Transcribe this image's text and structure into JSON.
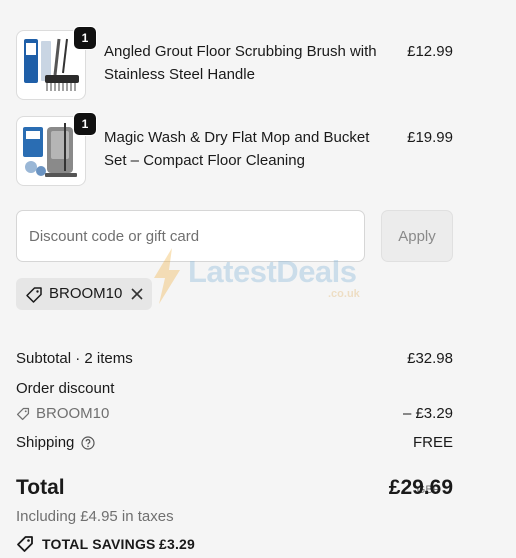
{
  "items": [
    {
      "name": "Angled Grout Floor Scrubbing Brush with Stainless Steel Handle",
      "price": "£12.99",
      "quantity": "1",
      "image_icon": "scrubbing-brush-icon"
    },
    {
      "name": "Magic Wash & Dry Flat Mop and Bucket Set – Compact Floor Cleaning",
      "price": "£19.99",
      "quantity": "1",
      "image_icon": "mop-bucket-icon"
    }
  ],
  "discount": {
    "placeholder": "Discount code or gift card",
    "apply_label": "Apply",
    "applied_code": "BROOM10"
  },
  "watermark": {
    "text": "LatestDeals",
    "sub": ".co.uk"
  },
  "summary": {
    "subtotal_label": "Subtotal · 2 items",
    "subtotal_value": "£32.98",
    "order_discount_label": "Order discount",
    "discount_code": "BROOM10",
    "discount_value": "– £3.29",
    "shipping_label": "Shipping",
    "shipping_value": "FREE",
    "total_label": "Total",
    "currency": "GBP",
    "total_value": "£29.69",
    "taxes_text": "Including £4.95 in taxes",
    "savings_label": "TOTAL SAVINGS",
    "savings_value": "£3.29"
  },
  "colors": {
    "background": "#f5f5f5",
    "badge": "#111111",
    "muted": "#707070"
  }
}
